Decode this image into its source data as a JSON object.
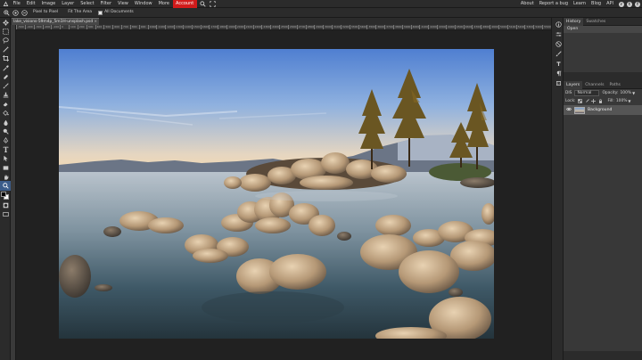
{
  "menubar": {
    "items": [
      "File",
      "Edit",
      "Image",
      "Layer",
      "Select",
      "Filter",
      "View",
      "Window",
      "More"
    ],
    "active_item": "Account",
    "right_links": [
      "About",
      "Report a bug",
      "Learn",
      "Blog",
      "API"
    ],
    "accent": "#d11b1b"
  },
  "options_bar": {
    "pixel_to_pixel": "Pixel to Pixel",
    "fit_area": "Fit The Area",
    "all_documents": "All Documents"
  },
  "document": {
    "tab_name": "lake_visions-59m4p_5m1H-unsplash.psd",
    "close": "×"
  },
  "ruler": {
    "ticks": [
      "-500",
      "-400",
      "-300",
      "-200",
      "-100",
      "0",
      "100",
      "200",
      "300",
      "400",
      "500",
      "600",
      "700",
      "800",
      "900",
      "1000",
      "1100",
      "1200",
      "1300",
      "1400",
      "1500",
      "1600",
      "1700",
      "1800",
      "1900",
      "2000",
      "2100",
      "2200",
      "2300",
      "2400",
      "2500",
      "2600",
      "2700",
      "2800",
      "2900",
      "3000",
      "3100",
      "3200",
      "3300",
      "3400",
      "3500",
      "3600",
      "3700",
      "3800",
      "3900",
      "4000",
      "4100",
      "4200",
      "4300",
      "4400",
      "4500",
      "4600",
      "4700",
      "4800",
      "4900",
      "5000",
      "5100",
      "5200",
      "5300",
      "5400",
      "5500"
    ]
  },
  "history_panel": {
    "tabs": [
      "History",
      "Swatches"
    ],
    "items": [
      "Open"
    ]
  },
  "layers_panel": {
    "tabs": [
      "Layers",
      "Channels",
      "Paths"
    ],
    "blend_label": "DIS",
    "blend_mode": "Normal",
    "opacity_label": "Opacity:",
    "opacity_value": "100%",
    "lock_label": "Lock:",
    "fill_label": "Fill:",
    "fill_value": "100%",
    "layers": [
      {
        "name": "Background"
      }
    ]
  }
}
